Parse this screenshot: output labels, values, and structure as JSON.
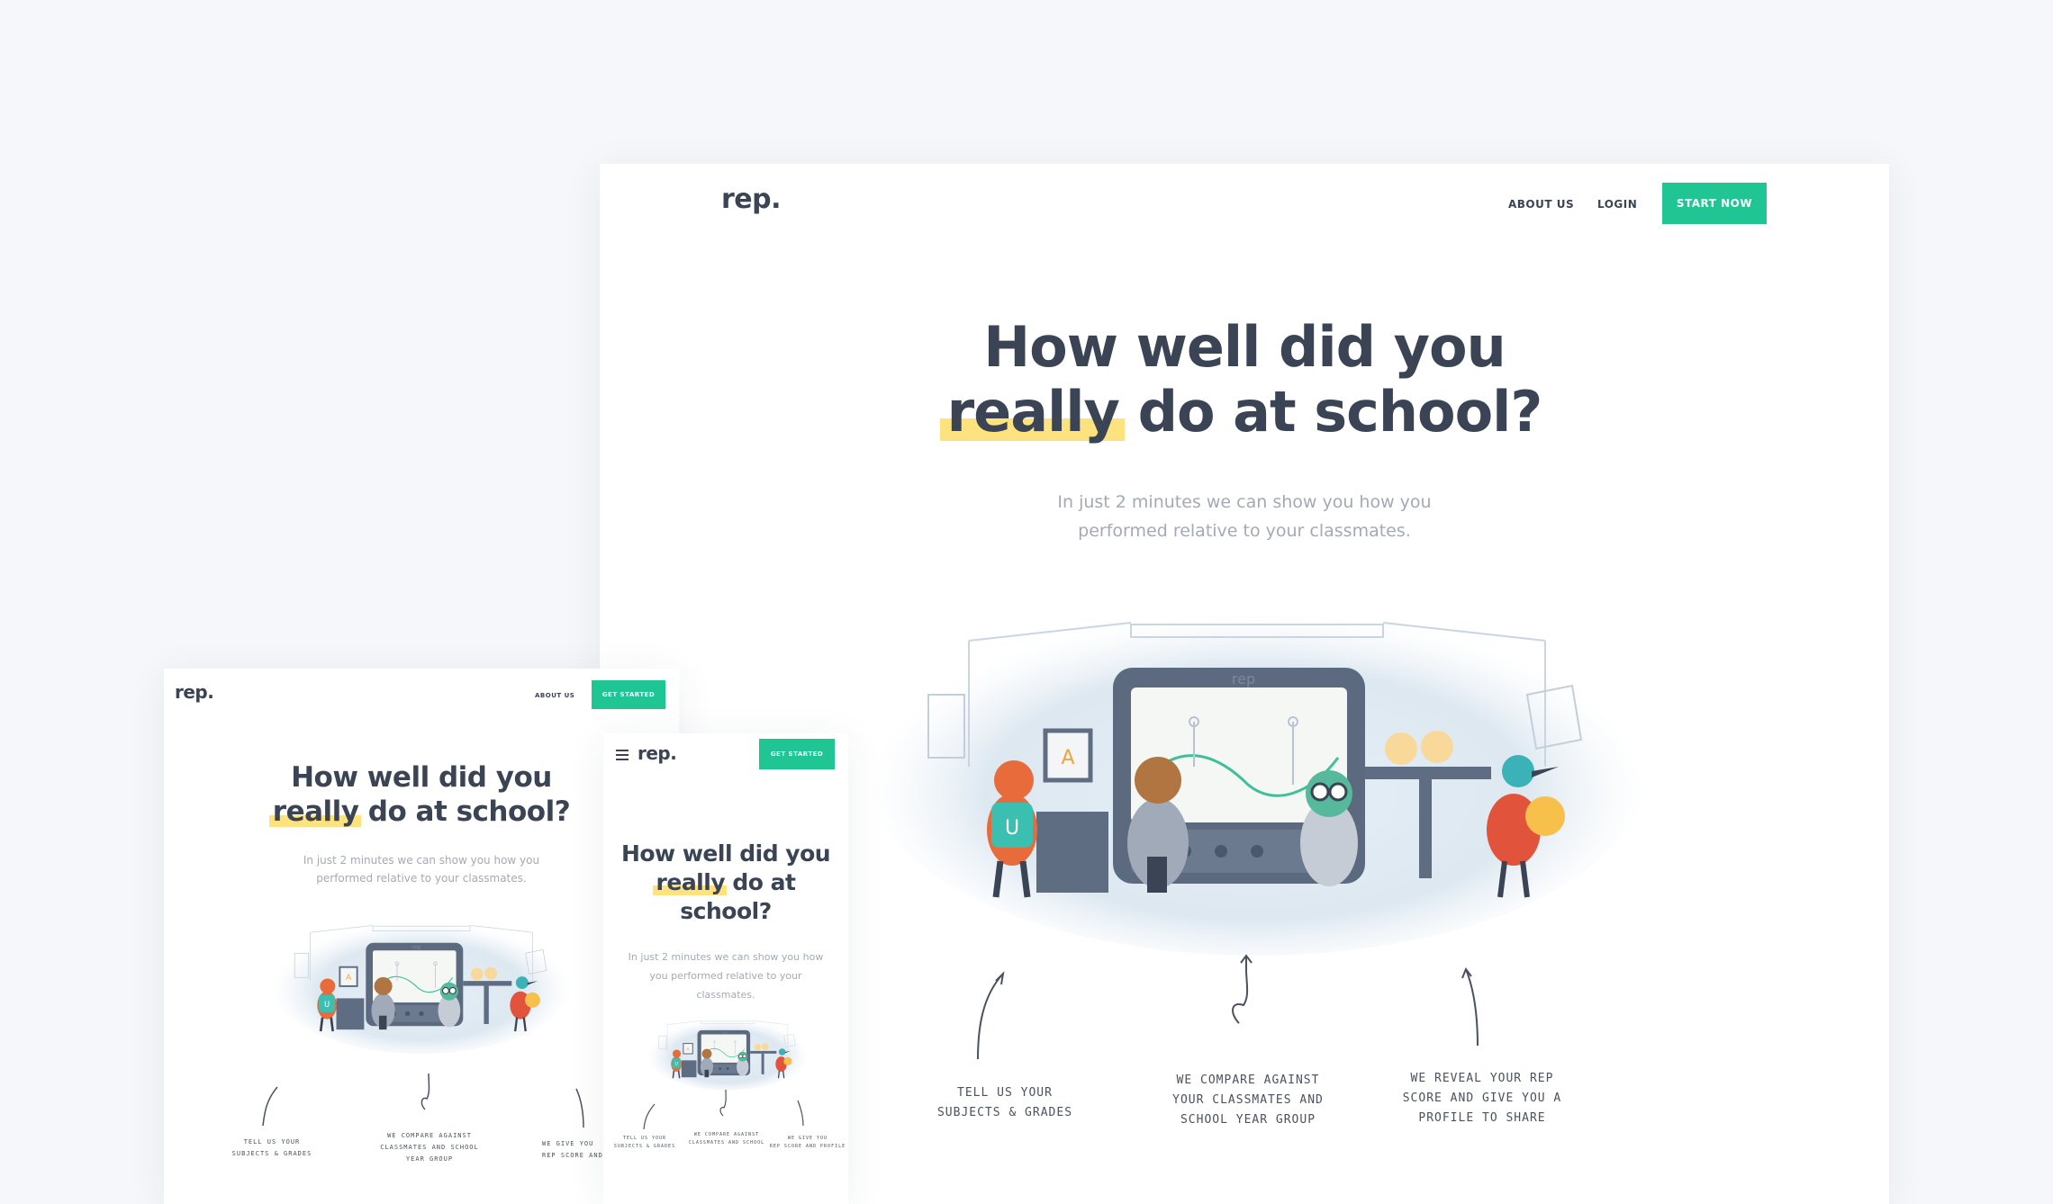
{
  "brand": {
    "logo": "rep.",
    "accent": "#1fc592",
    "highlight": "#fde27e",
    "text_color": "#3a4455"
  },
  "desktop": {
    "nav": {
      "about": "ABOUT US",
      "login": "LOGIN",
      "cta": "START NOW"
    },
    "headline": {
      "line1": "How well did you",
      "highlight": "really",
      "rest": "do at school?"
    },
    "subtitle": {
      "line1": "In just 2 minutes we can show you how you",
      "line2": "performed relative to your classmates."
    },
    "steps": [
      {
        "line1": "Tell us your",
        "line2": "Subjects & Grades",
        "line3": ""
      },
      {
        "line1": "We compare against",
        "line2": "your classmates and",
        "line3": "school year group"
      },
      {
        "line1": "We reveal your rep",
        "line2": "score and give you a",
        "line3": "profile to share"
      }
    ],
    "illustration": {
      "screen_label": "rep",
      "card_letter": "A",
      "fox_letter": "U"
    }
  },
  "tablet": {
    "nav": {
      "about": "ABOUT US",
      "cta": "GET STARTED"
    },
    "headline": {
      "line1": "How well did you",
      "highlight": "really",
      "rest": "do at school?"
    },
    "subtitle": {
      "line1": "In just 2 minutes we can show you how you",
      "line2": "performed relative to your classmates."
    },
    "steps": [
      {
        "line1": "Tell us your",
        "line2": "Subjects & Grades",
        "line3": ""
      },
      {
        "line1": "We compare against",
        "line2": "classmates and school",
        "line3": "year group"
      },
      {
        "line1": "We give you",
        "line2": "rep score and pr",
        "line3": ""
      }
    ]
  },
  "phone": {
    "nav": {
      "cta": "GET STARTED"
    },
    "headline": {
      "line1": "How well did you",
      "highlight": "really",
      "rest": "do at",
      "line3": "school?"
    },
    "subtitle": {
      "line1": "In just 2 minutes we can show you how",
      "line2": "you performed relative to your",
      "line3": "classmates."
    },
    "steps": [
      {
        "line1": "Tell us your",
        "line2": "Subjects & Grades"
      },
      {
        "line1": "We compare against",
        "line2": "classmates and school"
      },
      {
        "line1": "We give you",
        "line2": "rep score and profile"
      }
    ]
  }
}
